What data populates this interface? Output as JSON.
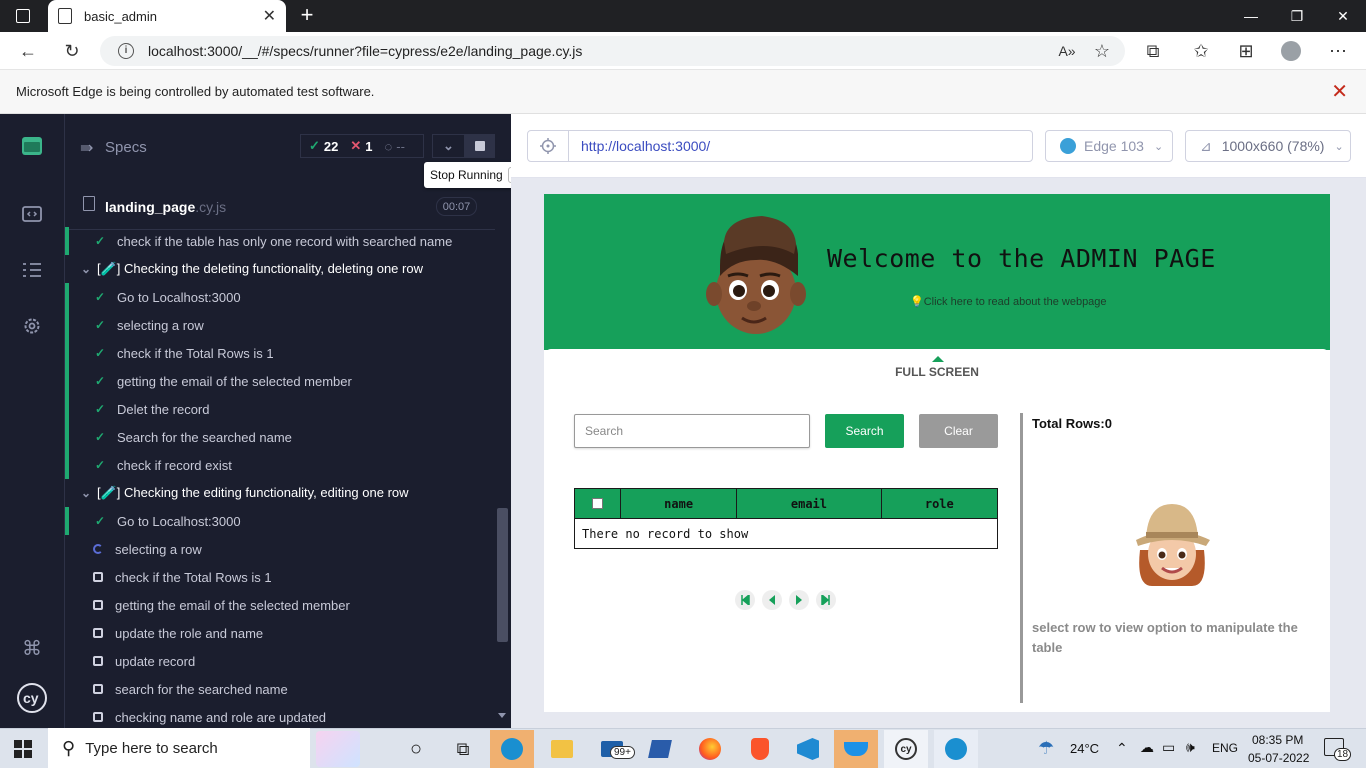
{
  "browser": {
    "tab_title": "basic_admin",
    "url": "localhost:3000/__/#/specs/runner?file=cypress/e2e/landing_page.cy.js",
    "infobar_text": "Microsoft Edge is being controlled by automated test software."
  },
  "reporter": {
    "specs_label": "Specs",
    "passed": "22",
    "failed": "1",
    "pending": "--",
    "tooltip": "Stop Running",
    "tooltip_key": "S",
    "spec_file": "landing_page",
    "spec_ext": ".cy.js",
    "duration": "00:07",
    "lines": [
      {
        "kind": "pass",
        "text": "check if the table has only one record with searched name",
        "bar": true
      },
      {
        "kind": "suite",
        "text": "[🧪] Checking the deleting functionality, deleting one row"
      },
      {
        "kind": "pass",
        "text": "Go to Localhost:3000",
        "bar": true
      },
      {
        "kind": "pass",
        "text": "selecting a row",
        "bar": true
      },
      {
        "kind": "pass",
        "text": "check if the Total Rows is 1",
        "bar": true
      },
      {
        "kind": "pass",
        "text": "getting the email of the selected member",
        "bar": true
      },
      {
        "kind": "pass",
        "text": "Delet the record",
        "bar": true
      },
      {
        "kind": "pass",
        "text": "Search for the searched name",
        "bar": true
      },
      {
        "kind": "pass",
        "text": "check if record exist",
        "bar": true
      },
      {
        "kind": "suite",
        "text": "[🧪] Checking the editing functionality, editing one row"
      },
      {
        "kind": "pass",
        "text": "Go to Localhost:3000",
        "bar": true
      },
      {
        "kind": "running",
        "text": "selecting a row"
      },
      {
        "kind": "pending",
        "text": "check if the Total Rows is 1"
      },
      {
        "kind": "pending",
        "text": "getting the email of the selected member"
      },
      {
        "kind": "pending",
        "text": "update the role and name"
      },
      {
        "kind": "pending",
        "text": "update record"
      },
      {
        "kind": "pending",
        "text": "search for the searched name"
      },
      {
        "kind": "pending",
        "text": "checking name and role are updated"
      }
    ]
  },
  "aut": {
    "url": "http://localhost:3000/",
    "browser": "Edge 103",
    "viewport": "1000x660 (78%)"
  },
  "app": {
    "title": "Welcome to the ADMIN PAGE",
    "read_about": "💡Click here to read about the webpage",
    "full_screen": "FULL SCREEN",
    "search_placeholder": "Search",
    "search_button": "Search",
    "clear_button": "Clear",
    "columns": [
      "name",
      "email",
      "role"
    ],
    "empty_message": "There no record to show",
    "total_rows": "Total Rows:0",
    "select_hint": "select row to view option to manipulate the table"
  },
  "taskbar": {
    "search_placeholder": "Type here to search",
    "mail_badge": "99+",
    "temperature": "24°C",
    "language": "ENG",
    "time": "08:35 PM",
    "date": "05-07-2022",
    "notifications": "18"
  },
  "colors": {
    "brand_green": "#16a05a",
    "cypress_bg": "#1b1e2e",
    "pass_green": "#1fa971",
    "fail_red": "#e45770"
  }
}
